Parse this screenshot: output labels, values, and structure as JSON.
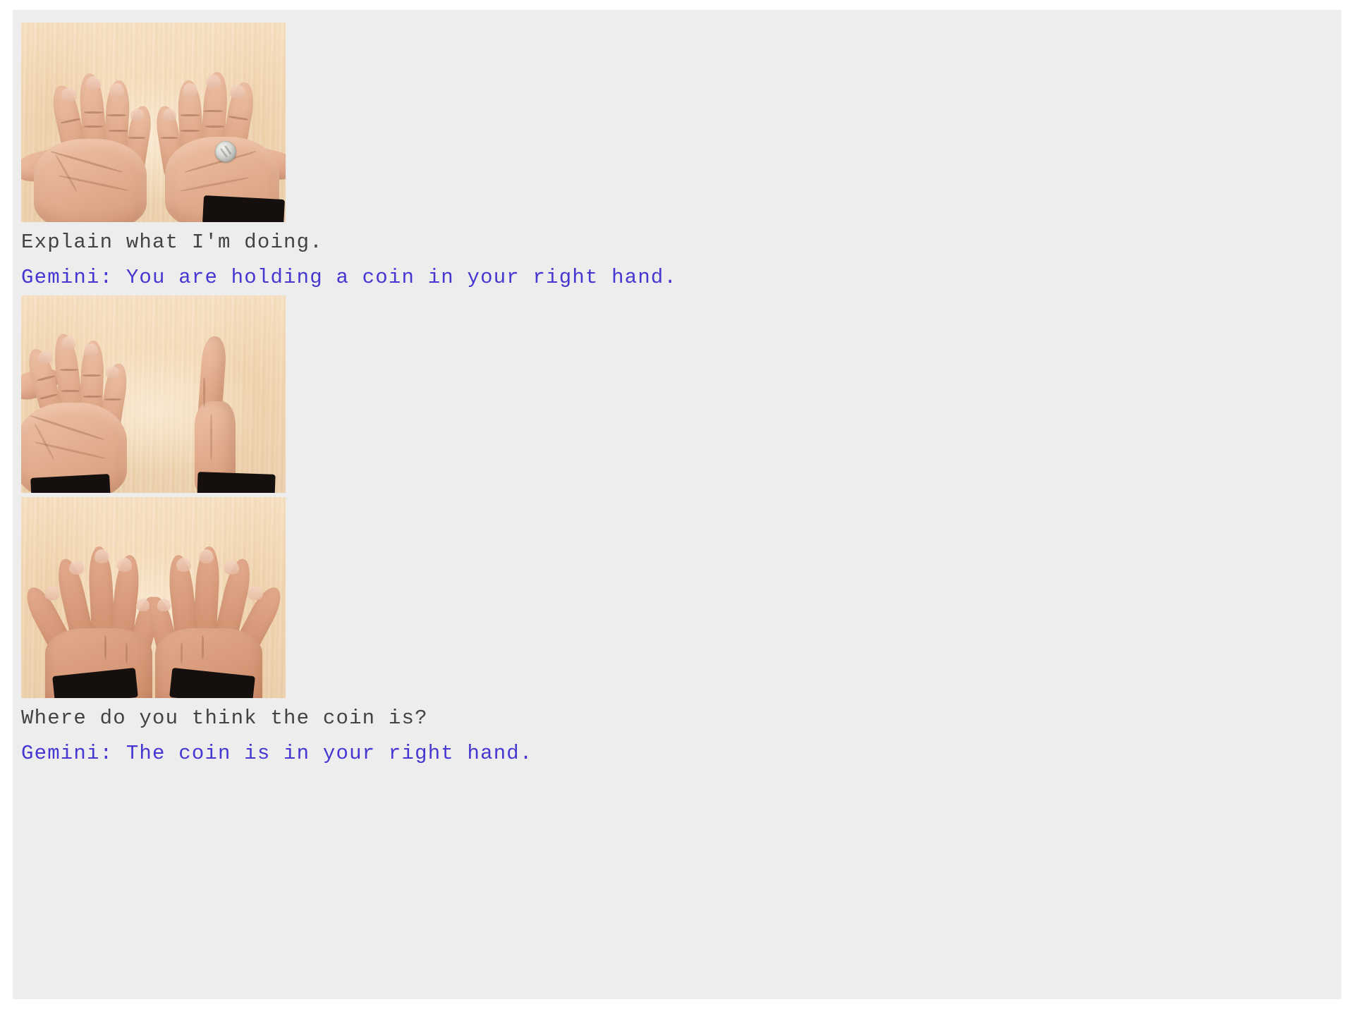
{
  "page": {
    "background_color": "#ffffff",
    "panel_color": "#ededed",
    "user_text_color": "#434343",
    "model_text_color": "#4737d2"
  },
  "conversation": {
    "turns": [
      {
        "id": "turn-1",
        "media": {
          "name": "hands-palms-up-with-coin",
          "alt": "Two open palms facing up on a light wooden table with a silver coin resting in the right palm",
          "surface": "light wood table",
          "objects": [
            "left hand palm up",
            "right hand palm up",
            "silver coin",
            "black sleeve cuffs"
          ]
        },
        "user_prompt": "Explain what I'm doing.",
        "model_prefix": "Gemini:",
        "model_response": "You are holding a coin in your right hand.",
        "model_line": "Gemini: You are holding a coin in your right hand."
      },
      {
        "id": "turn-2",
        "media": [
          {
            "name": "left-hand-flat-right-hand-edge-on",
            "alt": "Left hand lying flat palm up on the wooden table while the right hand is turned vertically edge-on",
            "surface": "light wood table",
            "objects": [
              "left hand palm up",
              "right hand edge on",
              "black sleeve cuffs"
            ]
          },
          {
            "name": "both-hands-palms-down",
            "alt": "Both hands resting palms down on the wooden table with fingers spread apart",
            "surface": "light wood table",
            "objects": [
              "left hand palm down",
              "right hand palm down",
              "black sleeve cuffs"
            ]
          }
        ],
        "user_prompt": "Where do you think the coin is?",
        "model_prefix": "Gemini:",
        "model_response": "The coin is in your right hand.",
        "model_line": "Gemini: The coin is in your right hand."
      }
    ]
  }
}
